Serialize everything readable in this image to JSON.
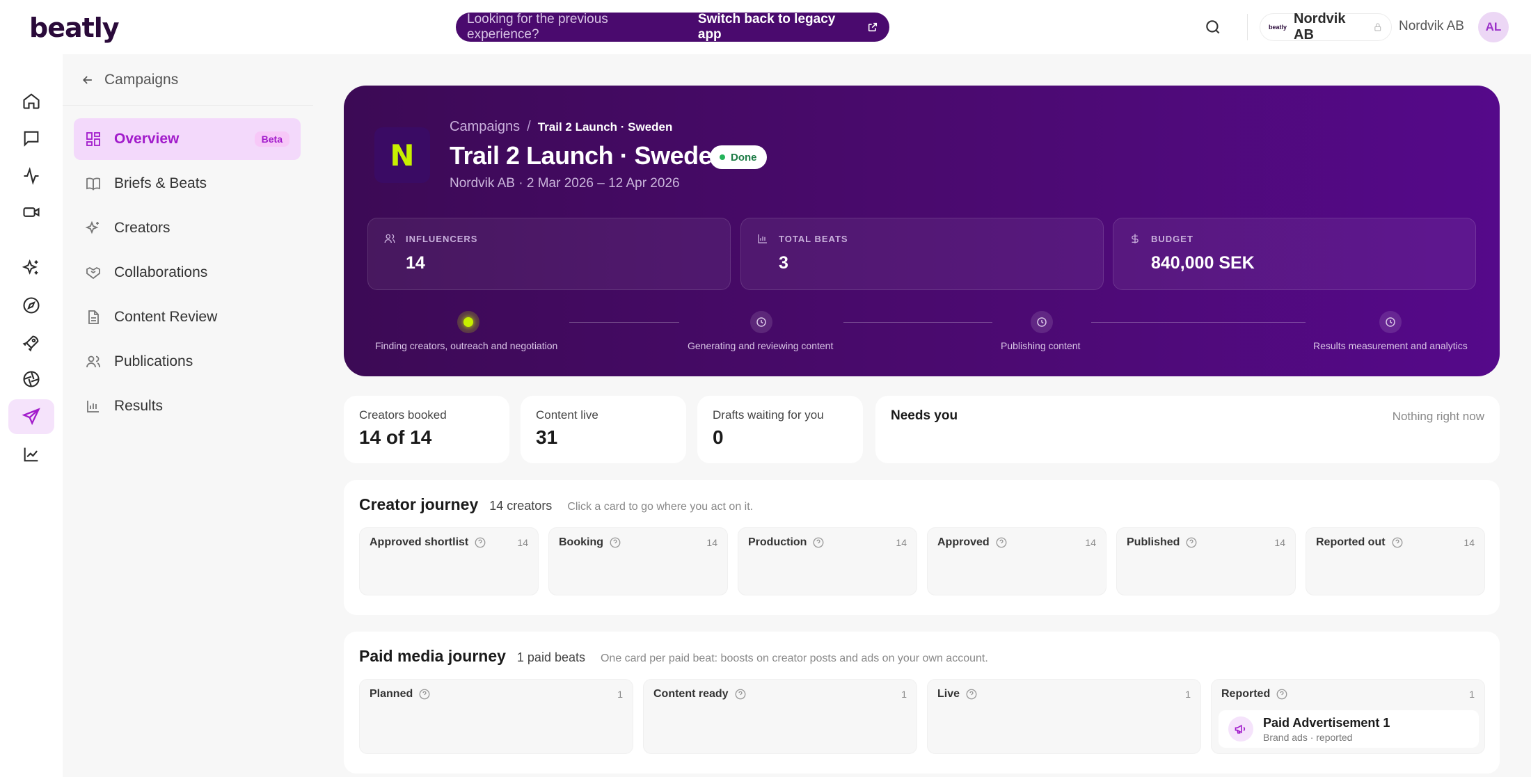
{
  "brand": {
    "logo": "beatly"
  },
  "banner": {
    "question": "Looking for the previous experience?",
    "link": "Switch back to legacy app"
  },
  "header": {
    "org_pill_logo": "beatly",
    "org_pill_name": "Nordvik AB",
    "org_name": "Nordvik AB",
    "avatar_initials": "AL"
  },
  "rail": [
    "home-icon",
    "chat-icon",
    "activity-icon",
    "video-icon",
    "sparkles-icon",
    "compass-icon",
    "rocket-icon",
    "aperture-icon",
    "send-icon",
    "chart-icon"
  ],
  "subnav": {
    "back_label": "Campaigns",
    "items": [
      {
        "label": "Overview",
        "badge": "Beta",
        "icon": "grid-icon"
      },
      {
        "label": "Briefs & Beats",
        "icon": "book-icon"
      },
      {
        "label": "Creators",
        "icon": "sparkle-icon"
      },
      {
        "label": "Collaborations",
        "icon": "handshake-icon"
      },
      {
        "label": "Content Review",
        "icon": "document-icon"
      },
      {
        "label": "Publications",
        "icon": "users-icon"
      },
      {
        "label": "Results",
        "icon": "bar-chart-icon"
      }
    ]
  },
  "hero": {
    "logo_letter": "N",
    "breadcrumb_root": "Campaigns",
    "breadcrumb_sep": "/",
    "breadcrumb_current": "Trail 2 Launch · Sweden",
    "title": "Trail 2 Launch · Sweden",
    "status": "Done",
    "subtitle": "Nordvik AB · 2 Mar 2026 – 12 Apr 2026",
    "stats": [
      {
        "label": "INFLUENCERS",
        "value": "14"
      },
      {
        "label": "TOTAL BEATS",
        "value": "3"
      },
      {
        "label": "BUDGET",
        "value": "840,000 SEK"
      }
    ],
    "steps": [
      "Finding creators, outreach and negotiation",
      "Generating and reviewing content",
      "Publishing content",
      "Results measurement and analytics"
    ]
  },
  "summary": {
    "creators_booked_label": "Creators booked",
    "creators_booked_value": "14 of 14",
    "content_live_label": "Content live",
    "content_live_value": "31",
    "drafts_label": "Drafts waiting for you",
    "drafts_value": "0",
    "needs_title": "Needs you",
    "needs_status": "Nothing right now"
  },
  "creator_journey": {
    "title": "Creator journey",
    "count": "14 creators",
    "hint": "Click a card to go where you act on it.",
    "columns": [
      {
        "label": "Approved shortlist",
        "count": "14"
      },
      {
        "label": "Booking",
        "count": "14"
      },
      {
        "label": "Production",
        "count": "14"
      },
      {
        "label": "Approved",
        "count": "14"
      },
      {
        "label": "Published",
        "count": "14"
      },
      {
        "label": "Reported out",
        "count": "14"
      }
    ]
  },
  "paid_journey": {
    "title": "Paid media journey",
    "count": "1 paid beats",
    "hint": "One card per paid beat: boosts on creator posts and ads on your own account.",
    "columns": [
      {
        "label": "Planned",
        "count": "1"
      },
      {
        "label": "Content ready",
        "count": "1"
      },
      {
        "label": "Live",
        "count": "1"
      },
      {
        "label": "Reported",
        "count": "1"
      }
    ],
    "card": {
      "title": "Paid Advertisement 1",
      "subtitle": "Brand ads · reported"
    }
  },
  "colors": {
    "accent": "#a21ccb",
    "hero": "#4a0a6e",
    "lime": "#c8f000",
    "success": "#1b7a44"
  }
}
